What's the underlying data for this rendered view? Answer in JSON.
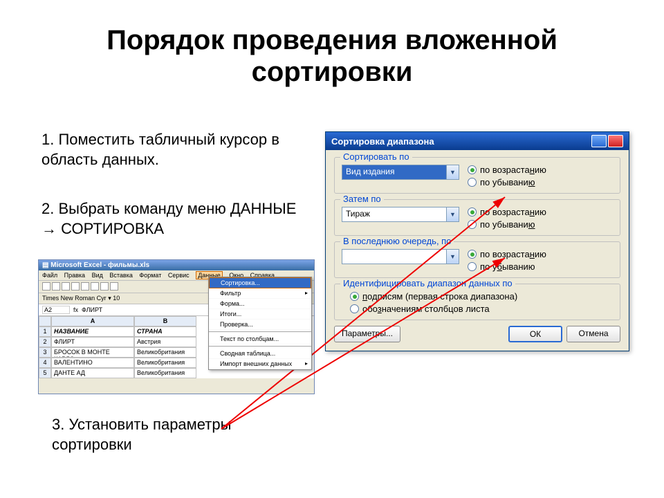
{
  "title": "Порядок проведения вложенной сортировки",
  "bullets": {
    "b1": "1. Поместить табличный курсор в область данных.",
    "b2": "2. Выбрать команду меню ДАННЫЕ → СОРТИРОВКА",
    "b3": "3. Установить параметры сортировки"
  },
  "excel": {
    "title": "Microsoft Excel - фильмы.xls",
    "menu": [
      "Файл",
      "Правка",
      "Вид",
      "Вставка",
      "Формат",
      "Сервис",
      "Данные",
      "Окно",
      "Справка"
    ],
    "menu_hl_index": 6,
    "font": "Times New Roman Cyr",
    "fontsize": "10",
    "cellref": "A2",
    "formula_label": "fx",
    "formula": "ФЛИРТ",
    "cols": [
      "",
      "A",
      "B"
    ],
    "headers_row_num": "1",
    "headers": [
      "НАЗВАНИЕ",
      "СТРАНА"
    ],
    "rows": [
      {
        "n": "2",
        "a": "ФЛИРТ",
        "b": "Австрия"
      },
      {
        "n": "3",
        "a": "БРОСОК В МОНТЕ КАРЛО",
        "b": "Великобритания"
      },
      {
        "n": "4",
        "a": "ВАЛЕНТИНО",
        "b": "Великобритания"
      },
      {
        "n": "5",
        "a": "ДАНТЕ АД",
        "b": "Великобритания"
      }
    ],
    "dropdown": {
      "sort": "Сортировка...",
      "filter": "Фильтр",
      "form": "Форма...",
      "totals": "Итоги...",
      "validation": "Проверка...",
      "text_cols": "Текст по столбцам...",
      "pivot": "Сводная таблица...",
      "import": "Импорт внешних данных"
    }
  },
  "dialog": {
    "title": "Сортировка диапазона",
    "grp1": "Сортировать по",
    "combo1": "Вид издания",
    "asc": "по возраста",
    "asc_u": "н",
    "asc2": "ию",
    "desc": "по убывани",
    "desc_u": "ю",
    "grp2": "Затем по",
    "combo2": "Тираж",
    "grp3": "В последнюю очередь, по",
    "combo3": "",
    "desc3_pre": "по у",
    "desc3_u": "б",
    "desc3_post": "ыванию",
    "grp4": "Идентифицировать диапазон данных по",
    "id1_u": "п",
    "id1": "одписям (первая строка диапазона)",
    "id2_pre": "обо",
    "id2_u": "з",
    "id2_post": "начениям столбцов листа",
    "btn_params": "Параметры...",
    "btn_ok": "ОК",
    "btn_cancel": "Отмена"
  }
}
